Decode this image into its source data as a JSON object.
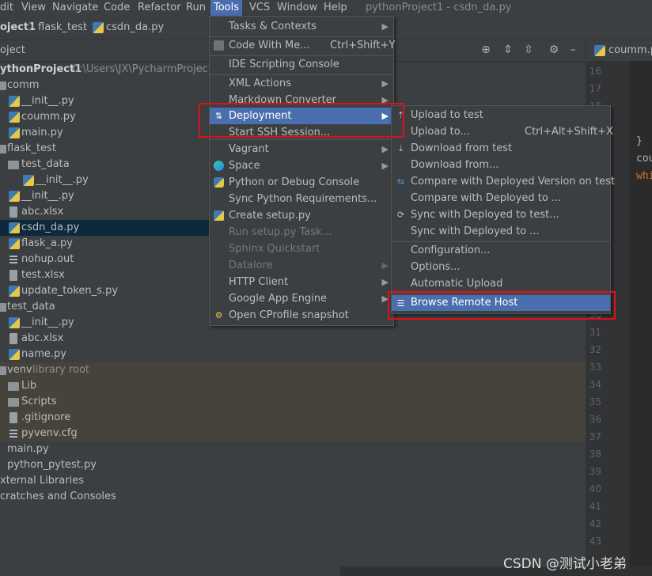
{
  "menubar": {
    "items": [
      "dit",
      "View",
      "Navigate",
      "Code",
      "Refactor",
      "Run",
      "Tools",
      "VCS",
      "Window",
      "Help"
    ],
    "title": "pythonProject1 - csdn_da.py"
  },
  "navbar": {
    "crumbs": [
      "oject1",
      "flask_test",
      "csdn_da.py"
    ]
  },
  "project_header": {
    "label": "oject"
  },
  "editor_tab": {
    "label": "coumm.py"
  },
  "tree": [
    {
      "label": "ythonProject1",
      "extra": "C:\\Users\\JX\\PycharmProjects\\"
    },
    {
      "label": "comm"
    },
    {
      "label": "__init__.py"
    },
    {
      "label": "coumm.py"
    },
    {
      "label": "main.py"
    },
    {
      "label": "flask_test"
    },
    {
      "label": "test_data"
    },
    {
      "label": "__init__.py"
    },
    {
      "label": "__init__.py"
    },
    {
      "label": "abc.xlsx"
    },
    {
      "label": "csdn_da.py"
    },
    {
      "label": "flask_a.py"
    },
    {
      "label": "nohup.out"
    },
    {
      "label": "test.xlsx"
    },
    {
      "label": "update_token_s.py"
    },
    {
      "label": "test_data"
    },
    {
      "label": "__init__.py"
    },
    {
      "label": "abc.xlsx"
    },
    {
      "label": "name.py"
    },
    {
      "label": "venv",
      "extra": "library root"
    },
    {
      "label": "Lib"
    },
    {
      "label": "Scripts"
    },
    {
      "label": ".gitignore"
    },
    {
      "label": "pyvenv.cfg"
    },
    {
      "label": "main.py"
    },
    {
      "label": "python_pytest.py"
    },
    {
      "label": "xternal Libraries"
    },
    {
      "label": "cratches and Consoles"
    }
  ],
  "editor": {
    "lines": [
      "16",
      "17",
      "18",
      "",
      "",
      "",
      "",
      "",
      "",
      "",
      "",
      "",
      "",
      "",
      "",
      "30",
      "31",
      "32",
      "33",
      "34",
      "35",
      "36",
      "37",
      "38",
      "39",
      "40",
      "41",
      "42",
      "43"
    ],
    "code": [
      "}",
      "cou",
      "whi"
    ]
  },
  "tools_menu": [
    {
      "label": "Tasks & Contexts",
      "arrow": true
    },
    {
      "label": "Code With Me...",
      "shortcut": "Ctrl+Shift+Y"
    },
    {
      "label": "IDE Scripting Console"
    },
    {
      "label": "XML Actions",
      "arrow": true
    },
    {
      "label": "Markdown Converter",
      "arrow": true
    },
    {
      "label": "Deployment",
      "arrow": true
    },
    {
      "label": "Start SSH Session..."
    },
    {
      "label": "Vagrant",
      "arrow": true
    },
    {
      "label": "Space",
      "arrow": true
    },
    {
      "label": "Python or Debug Console"
    },
    {
      "label": "Sync Python Requirements..."
    },
    {
      "label": "Create setup.py"
    },
    {
      "label": "Run setup.py Task..."
    },
    {
      "label": "Sphinx Quickstart"
    },
    {
      "label": "Datalore",
      "arrow": true
    },
    {
      "label": "HTTP Client",
      "arrow": true
    },
    {
      "label": "Google App Engine",
      "arrow": true
    },
    {
      "label": "Open CProfile snapshot"
    }
  ],
  "deployment_menu": [
    {
      "label": "Upload to test"
    },
    {
      "label": "Upload to...",
      "shortcut": "Ctrl+Alt+Shift+X"
    },
    {
      "label": "Download from test"
    },
    {
      "label": "Download from..."
    },
    {
      "label": "Compare with Deployed Version on test"
    },
    {
      "label": "Compare with Deployed to ..."
    },
    {
      "label": "Sync with Deployed to test..."
    },
    {
      "label": "Sync with Deployed to ..."
    },
    {
      "label": "Configuration..."
    },
    {
      "label": "Options..."
    },
    {
      "label": "Automatic Upload"
    },
    {
      "label": "Browse Remote Host"
    }
  ],
  "watermark": "CSDN @测试小老弟",
  "colors": {
    "highlight": "#4b6eaf",
    "annotation": "#e0101a",
    "selection": "#0d293e"
  }
}
